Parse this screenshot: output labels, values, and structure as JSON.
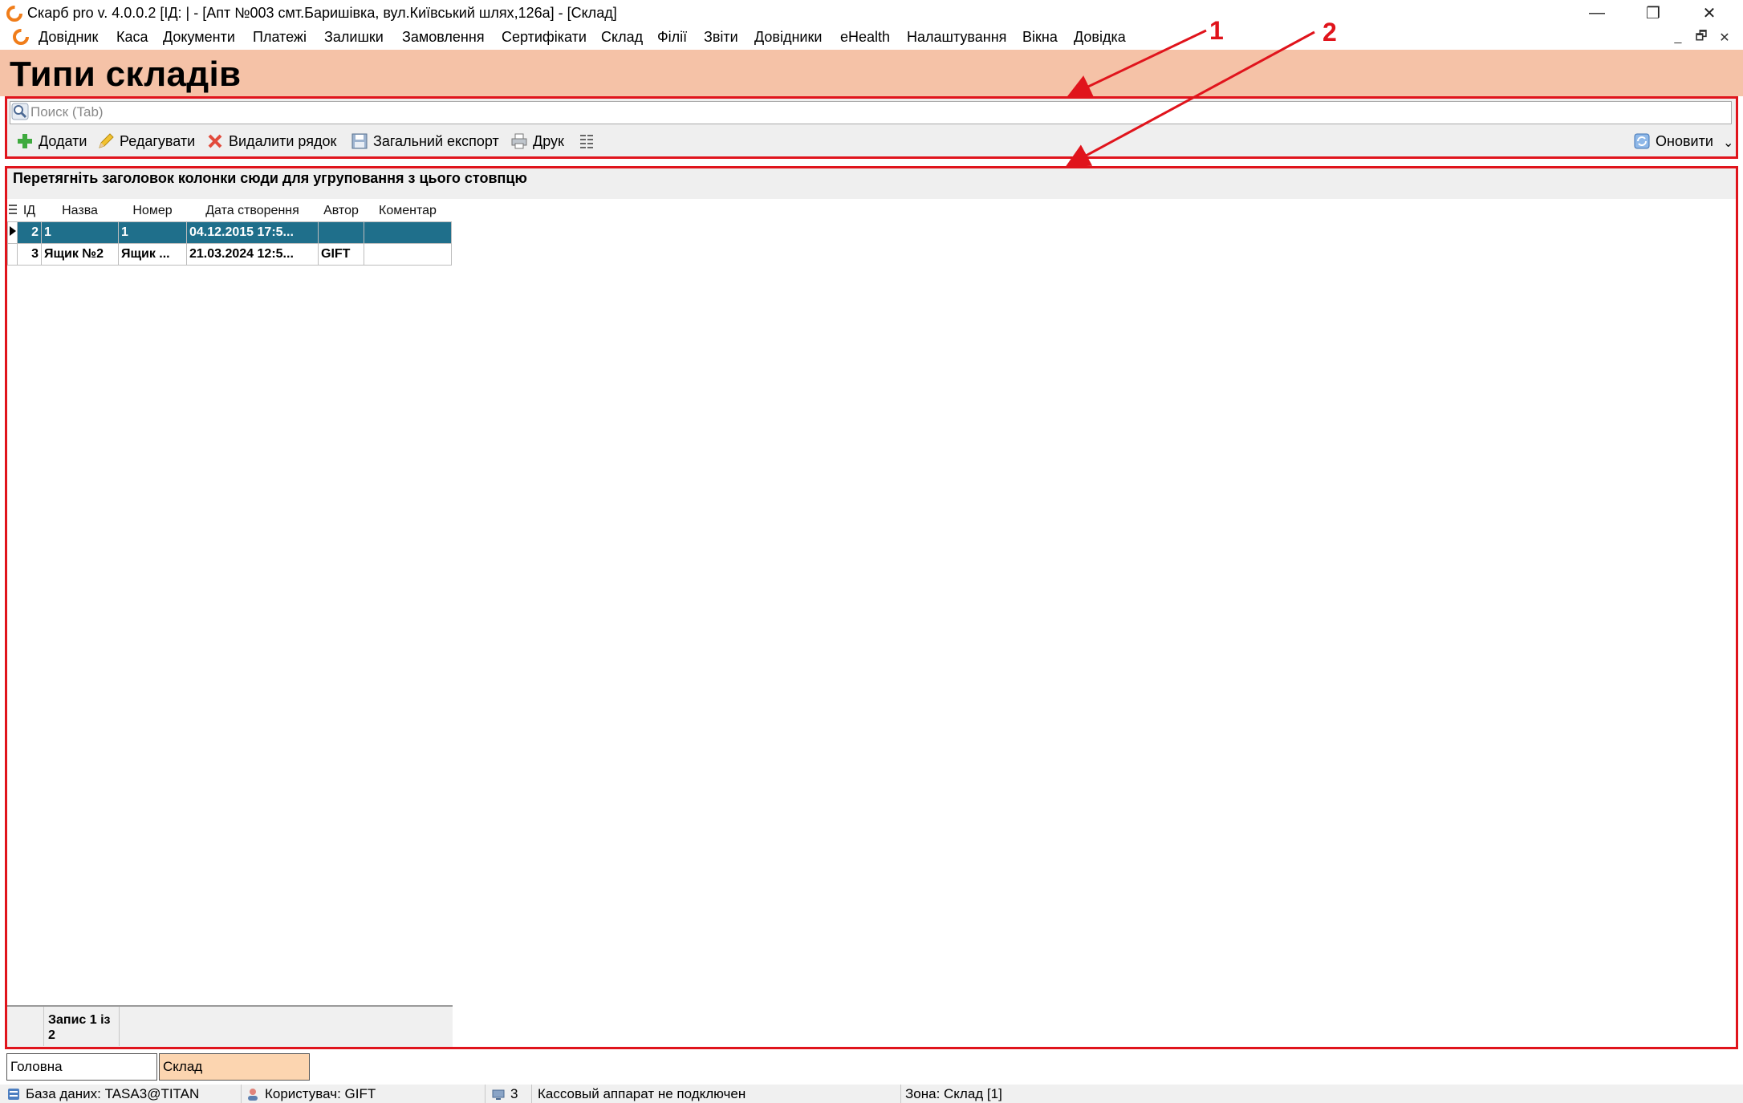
{
  "window": {
    "title": "Скарб pro v. 4.0.0.2 [ІД:        | - [Апт №003 смт.Баришівка, вул.Київський шлях,126а] - [Склад]",
    "minimize": "—",
    "maximize": "❐",
    "close": "✕"
  },
  "menu": {
    "items": [
      "Довідник",
      "Каса",
      "Документи",
      "Платежі",
      "Залишки",
      "Замовлення",
      "Сертифікати",
      "Склад",
      "Філії",
      "Звіти",
      "Довідники",
      "eHealth",
      "Налаштування",
      "Вікна",
      "Довідка"
    ],
    "mdi_minimize": "_",
    "mdi_restore": "🗗",
    "mdi_close": "✕"
  },
  "page": {
    "title": "Типи складів"
  },
  "search": {
    "placeholder": "Поиск (Tab)"
  },
  "toolbar": {
    "add": "Додати",
    "edit": "Редагувати",
    "delete": "Видалити рядок",
    "export": "Загальний експорт",
    "print": "Друк",
    "refresh": "Оновити",
    "dropdown": "⌄"
  },
  "grid": {
    "group_hint": "Перетягніть заголовок колонки сюди для угруповання з цього стовпцю",
    "columns": [
      "ІД",
      "Назва",
      "Номер",
      "Дата створення",
      "Автор",
      "Коментар"
    ],
    "rows": [
      {
        "id": "2",
        "name": "1",
        "number": "1",
        "created": "04.12.2015 17:5...",
        "author": "",
        "comment": ""
      },
      {
        "id": "3",
        "name": "Ящик №2",
        "number": "Ящик ...",
        "created": "21.03.2024 12:5...",
        "author": "GIFT",
        "comment": ""
      }
    ],
    "selected_row": 0,
    "record_count": "Запис 1 із 2"
  },
  "tabs": [
    "Головна",
    "Склад"
  ],
  "active_tab": 1,
  "status": {
    "database": "База даних: TASA3@TITAN",
    "user": "Користувач: GIFT",
    "count": "3",
    "register": "Кассовый аппарат не подключен",
    "zone": "Зона: Склад [1]"
  },
  "annotations": [
    "1",
    "2"
  ],
  "colors": {
    "header_bg": "#f5c2a7",
    "selected_row": "#1f6f8b",
    "annotation": "#e0141c",
    "active_tab": "#fcd5b0"
  }
}
